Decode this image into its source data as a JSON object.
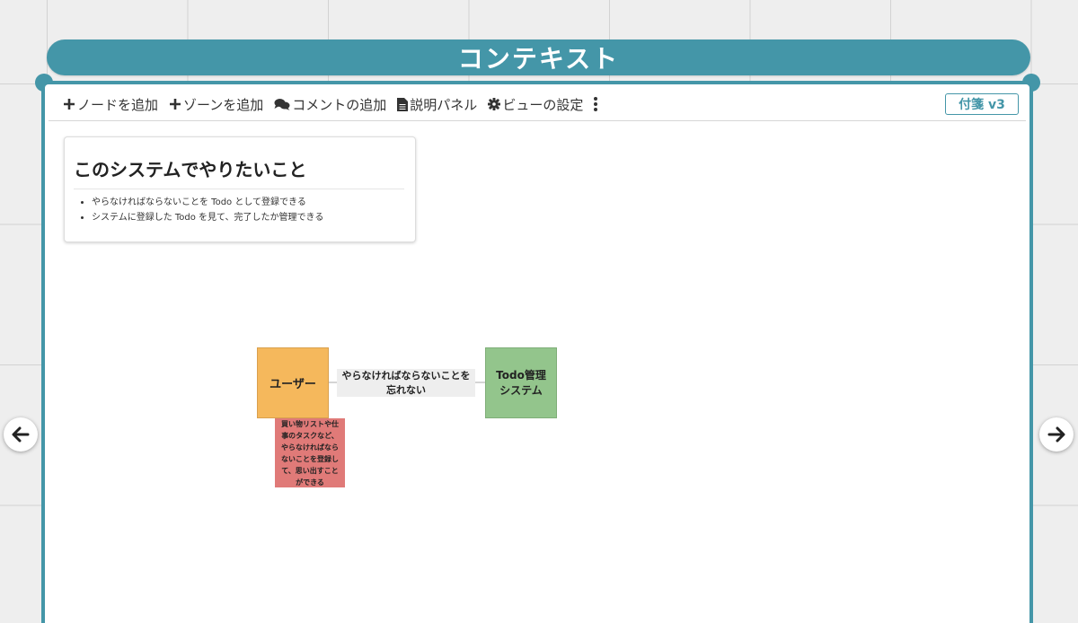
{
  "header": {
    "title": "コンテキスト"
  },
  "toolbar": {
    "add_node": "ノードを追加",
    "add_zone": "ゾーンを追加",
    "add_comment": "コメントの追加",
    "description_panel": "説明パネル",
    "view_settings": "ビューの設定",
    "version_badge": "付箋 v3"
  },
  "description_panel": {
    "title": "このシステムでやりたいこと",
    "items": [
      "やらなければならないことを Todo として登録できる",
      "システムに登録した Todo を見て、完了したか管理できる"
    ]
  },
  "canvas": {
    "nodes": {
      "user": {
        "label": "ユーザー",
        "color": "#f5b85c"
      },
      "todo_system": {
        "label_line1": "Todo管理",
        "label_line2": "システム",
        "color": "#93c58c"
      }
    },
    "edge_label": {
      "line1": "やらなければならないことを",
      "line2": "忘れない"
    },
    "comment": {
      "color": "#e07a78",
      "lines": [
        "買い物リストや仕",
        "事のタスクなど、",
        "やらなければなら",
        "ないことを登録し",
        "て、思い出すこと",
        "ができる"
      ]
    }
  },
  "icons": {
    "add_node": "plus-icon",
    "add_zone": "plus-icon",
    "add_comment": "comments-icon",
    "description_panel": "file-icon",
    "view_settings": "gear-icon",
    "more": "ellipsis-vertical-icon",
    "prev": "arrow-left-icon",
    "next": "arrow-right-icon"
  },
  "colors": {
    "accent": "#4496a8",
    "background": "#eeeeee"
  }
}
